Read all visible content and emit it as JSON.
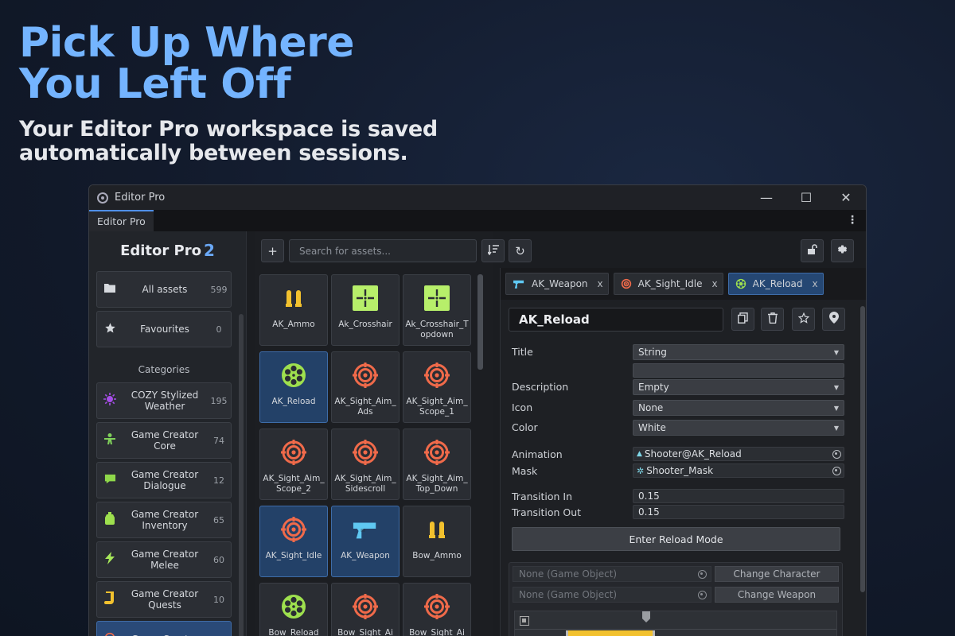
{
  "hero": {
    "title_line1": "Pick Up Where",
    "title_line2": "You Left Off",
    "sub_line1": "Your Editor Pro workspace is saved",
    "sub_line2": "automatically between sessions."
  },
  "window": {
    "title": "Editor Pro",
    "tab": "Editor Pro",
    "minimize": "—",
    "maximize": "☐",
    "close": "✕",
    "kebab": "⋮"
  },
  "sidebar": {
    "logo_text": "Editor Pro",
    "logo_num": "2",
    "all_assets": {
      "label": "All assets",
      "count": "599"
    },
    "favourites": {
      "label": "Favourites",
      "count": "0"
    },
    "categories_heading": "Categories",
    "categories": [
      {
        "label": "COZY Stylized Weather",
        "count": "195",
        "icon": "sun-icon",
        "color": "#a64ee8"
      },
      {
        "label": "Game Creator Core",
        "count": "74",
        "icon": "person-icon",
        "color": "#7fcf5a"
      },
      {
        "label": "Game Creator Dialogue",
        "count": "12",
        "icon": "speech-icon",
        "color": "#8fd84a"
      },
      {
        "label": "Game Creator Inventory",
        "count": "65",
        "icon": "bag-icon",
        "color": "#9ee04e"
      },
      {
        "label": "Game Creator Melee",
        "count": "60",
        "icon": "bolt-icon",
        "color": "#a7e85a"
      },
      {
        "label": "Game Creator Quests",
        "count": "10",
        "icon": "scroll-icon",
        "color": "#f2c12e"
      },
      {
        "label": "Game Creator",
        "count": "",
        "icon": "target-icon",
        "color": "#f06a4a"
      }
    ]
  },
  "assets": {
    "search_placeholder": "Search for assets...",
    "add": "+",
    "refresh": "↻",
    "items": [
      {
        "name": "AK_Ammo",
        "icon": "ammo",
        "selected": false
      },
      {
        "name": "Ak_Crosshair",
        "icon": "crosshair",
        "selected": false
      },
      {
        "name": "Ak_Crosshair_Topdown",
        "icon": "crosshair",
        "selected": false
      },
      {
        "name": "AK_Reload",
        "icon": "revolver",
        "selected": true
      },
      {
        "name": "AK_Sight_Aim_Ads",
        "icon": "target",
        "selected": false
      },
      {
        "name": "AK_Sight_Aim_Scope_1",
        "icon": "target",
        "selected": false
      },
      {
        "name": "AK_Sight_Aim_Scope_2",
        "icon": "target",
        "selected": false
      },
      {
        "name": "AK_Sight_Aim_Sidescroll",
        "icon": "target",
        "selected": false
      },
      {
        "name": "AK_Sight_Aim_Top_Down",
        "icon": "target",
        "selected": false
      },
      {
        "name": "AK_Sight_Idle",
        "icon": "target",
        "selected": true
      },
      {
        "name": "AK_Weapon",
        "icon": "gun",
        "selected": true
      },
      {
        "name": "Bow_Ammo",
        "icon": "ammo",
        "selected": false
      },
      {
        "name": "Bow_Reload",
        "icon": "revolver",
        "selected": false
      },
      {
        "name": "Bow_Sight_Ai",
        "icon": "target",
        "selected": false
      },
      {
        "name": "Bow_Sight_Ai",
        "icon": "target",
        "selected": false
      }
    ]
  },
  "inspector": {
    "tabs": [
      {
        "label": "AK_Weapon",
        "icon": "gun",
        "active": false
      },
      {
        "label": "AK_Sight_Idle",
        "icon": "target",
        "active": false
      },
      {
        "label": "AK_Reload",
        "icon": "revolver",
        "active": true
      }
    ],
    "tab_close": "x",
    "name": "AK_Reload",
    "title_label": "Title",
    "title_value": "String",
    "description_label": "Description",
    "description_value": "Empty",
    "icon_label": "Icon",
    "icon_value": "None",
    "color_label": "Color",
    "color_value": "White",
    "animation_label": "Animation",
    "animation_value": "Shooter@AK_Reload",
    "mask_label": "Mask",
    "mask_value": "Shooter_Mask",
    "transition_in_label": "Transition In",
    "transition_in_value": "0.15",
    "transition_out_label": "Transition Out",
    "transition_out_value": "0.15",
    "enter_button": "Enter Reload Mode",
    "object1": "None (Game Object)",
    "object2": "None (Game Object)",
    "change_character": "Change Character",
    "change_weapon": "Change Weapon"
  },
  "colors": {
    "accent": "#4f8fe8",
    "selection": "#234168",
    "ammo": "#f2c12e",
    "crosshair": "#b7ef6a",
    "revolver": "#9ee04e",
    "target": "#f06a4a",
    "gun": "#5fc8f2"
  }
}
